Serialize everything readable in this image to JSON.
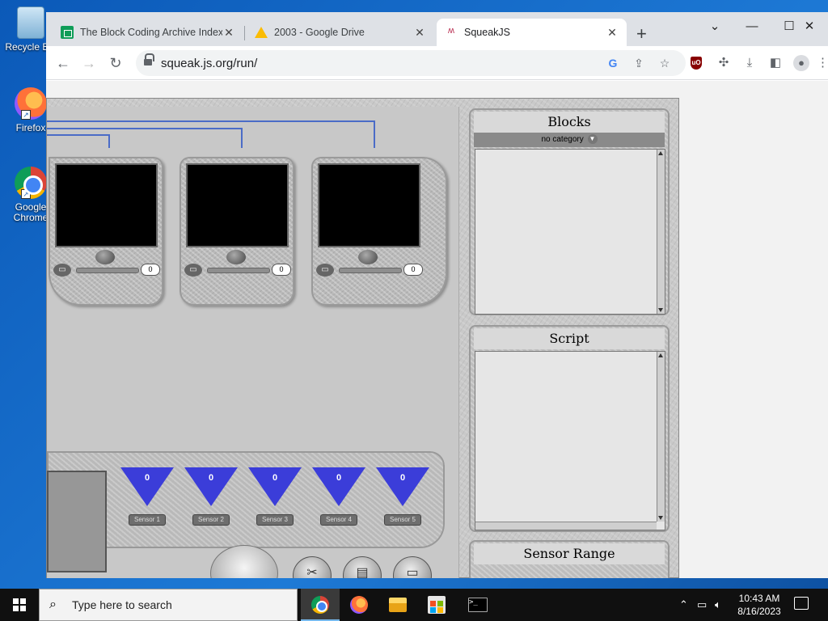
{
  "desktop": {
    "icons": [
      {
        "label": "Recycle Bin",
        "icon": "recycle-bin-icon"
      },
      {
        "label": "Firefox",
        "icon": "firefox-icon"
      },
      {
        "label": "Google Chrome",
        "icon": "chrome-icon"
      }
    ]
  },
  "browser": {
    "tabs": [
      {
        "title": "The Block Coding Archive Index",
        "icon": "google-sheets-icon"
      },
      {
        "title": "2003 - Google Drive",
        "icon": "google-drive-icon"
      },
      {
        "title": "SqueakJS",
        "icon": "squeak-icon"
      }
    ],
    "active_tab": 2,
    "new_tab": "+",
    "url": "squeak.js.org/run/"
  },
  "squeak": {
    "rcx_units": [
      {
        "value": "0"
      },
      {
        "value": "0"
      },
      {
        "value": "0"
      }
    ],
    "sensors": [
      {
        "value": "0",
        "label": "Sensor 1"
      },
      {
        "value": "0",
        "label": "Sensor 2"
      },
      {
        "value": "0",
        "label": "Sensor 3"
      },
      {
        "value": "0",
        "label": "Sensor 4"
      },
      {
        "value": "0",
        "label": "Sensor 5"
      }
    ],
    "blocks_panel": {
      "title": "Blocks",
      "category": "no category"
    },
    "script_panel": {
      "title": "Script"
    },
    "sensor_range_panel": {
      "title": "Sensor Range"
    },
    "colors": {
      "wire": "#4b6cc7",
      "sensor_triangle": "#3b3dd9"
    }
  },
  "taskbar": {
    "search_placeholder": "Type here to search",
    "time": "10:43 AM",
    "date": "8/16/2023"
  }
}
